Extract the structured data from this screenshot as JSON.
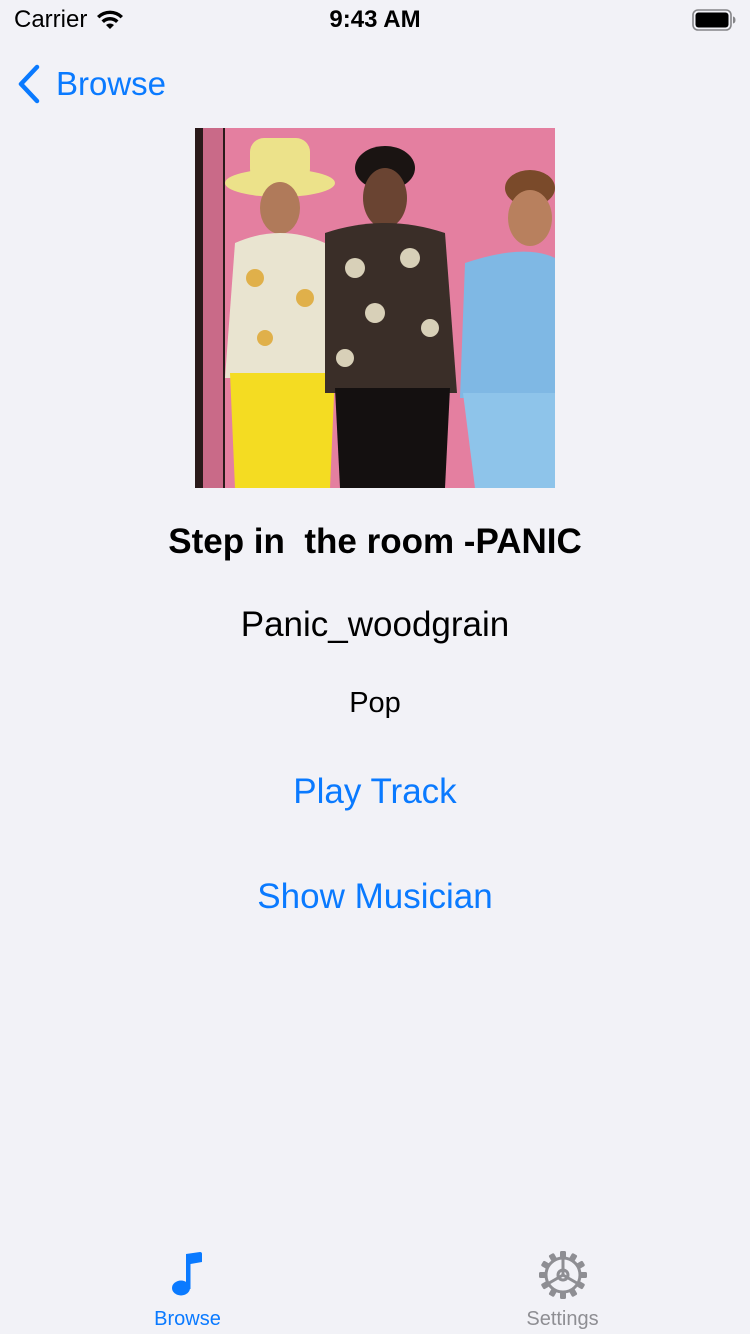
{
  "status_bar": {
    "carrier": "Carrier",
    "time": "9:43 AM"
  },
  "nav": {
    "back_label": "Browse"
  },
  "track": {
    "title": "Step in  the room -PANIC",
    "artist": "Panic_woodgrain",
    "genre": "Pop"
  },
  "actions": {
    "play_track": "Play Track",
    "show_musician": "Show Musician"
  },
  "tab_bar": {
    "tabs": [
      {
        "label": "Browse",
        "icon": "music-note-icon",
        "selected": true
      },
      {
        "label": "Settings",
        "icon": "gear-icon",
        "selected": false
      }
    ]
  },
  "colors": {
    "accent": "#0a7aff",
    "background": "#f2f2f7",
    "inactive": "#8e8e93",
    "album_background": "#e47fa0"
  }
}
